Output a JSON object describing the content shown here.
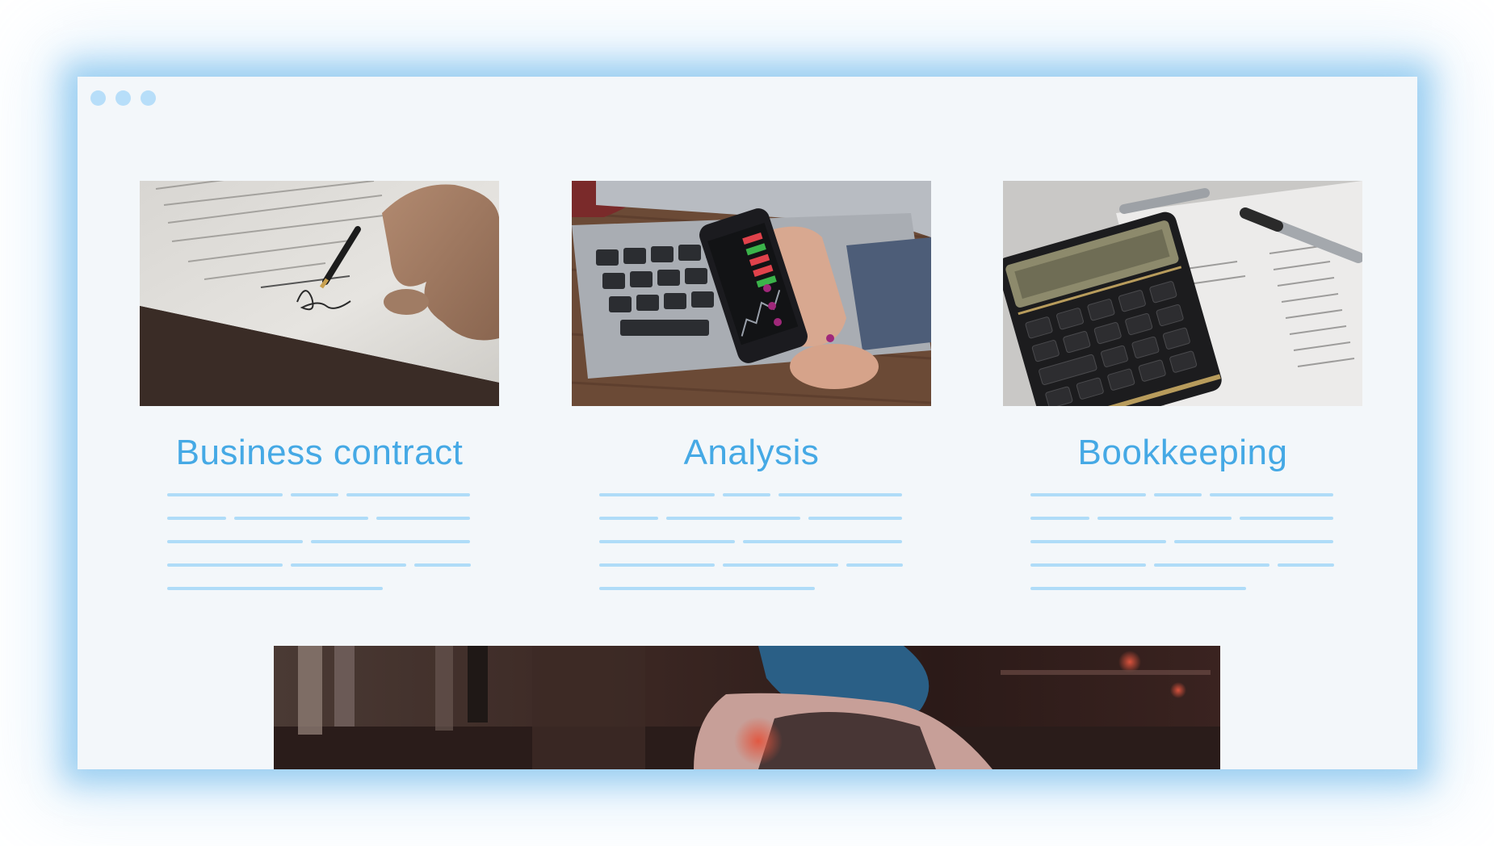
{
  "window": {
    "controls": [
      "window-dot-1",
      "window-dot-2",
      "window-dot-3"
    ]
  },
  "cards": [
    {
      "title": "Business contract",
      "image": "contract-signing-photo"
    },
    {
      "title": "Analysis",
      "image": "stock-app-on-phone-photo"
    },
    {
      "title": "Bookkeeping",
      "image": "calculator-and-documents-photo"
    }
  ],
  "hero": {
    "image": "person-in-street-photo"
  },
  "colors": {
    "accent": "#45a9e5",
    "placeholder_line": "#afdcf8",
    "window_dots": "#b7def9",
    "page_background": "#f3f7fa",
    "glow": "#5cb0e8"
  }
}
